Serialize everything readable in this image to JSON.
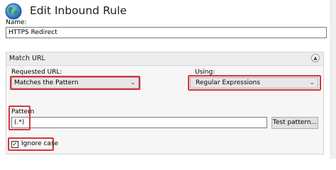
{
  "header": {
    "title": "Edit Inbound Rule",
    "icon": "globe-icon"
  },
  "name": {
    "label": "Name:",
    "value": "HTTPS Redirect"
  },
  "match_url": {
    "title": "Match URL",
    "collapse_icon": "chevron-up-icon",
    "requested_url": {
      "label": "Requested URL:",
      "value": "Matches the Pattern"
    },
    "using": {
      "label": "Using:",
      "value": "Regular Expressions"
    },
    "pattern": {
      "label": "Pattern",
      "value": "(.*)"
    },
    "test_button": "Test pattern...",
    "ignore_case": {
      "label": "Ignore case",
      "checked": true
    }
  },
  "colors": {
    "highlight": "#d8343b",
    "panel_bg": "#f6f6f6"
  }
}
